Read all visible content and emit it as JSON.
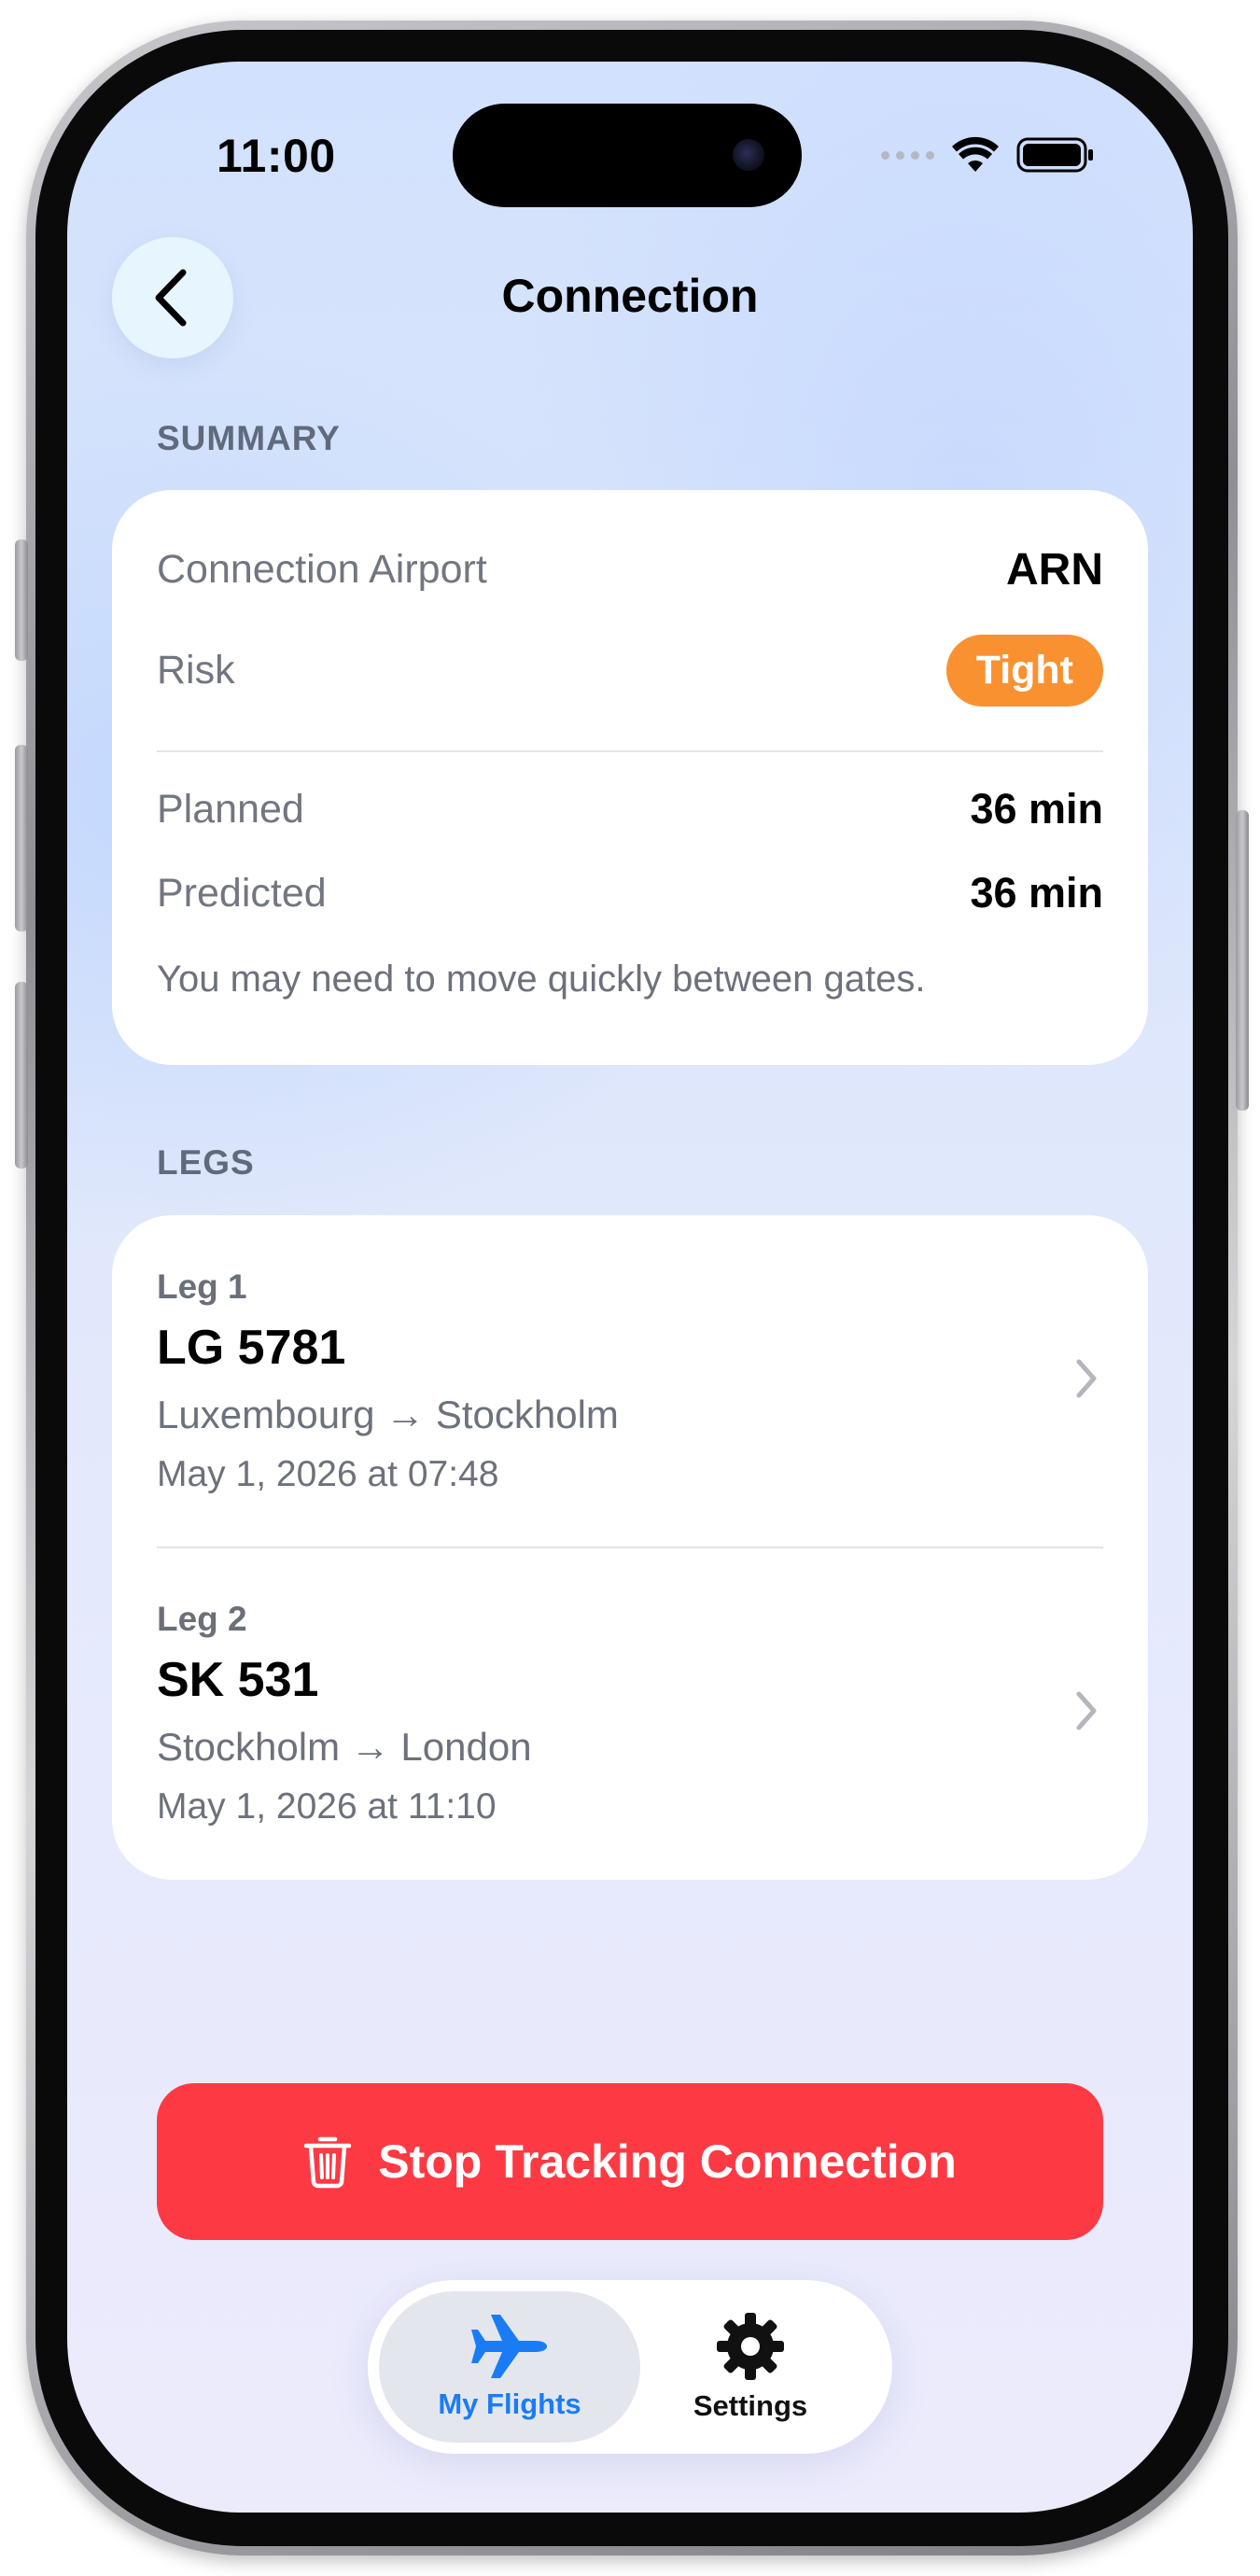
{
  "status_bar": {
    "time": "11:00"
  },
  "nav": {
    "title": "Connection"
  },
  "summary": {
    "section_label": "SUMMARY",
    "connection_airport_label": "Connection Airport",
    "connection_airport_value": "ARN",
    "risk_label": "Risk",
    "risk_value": "Tight",
    "planned_label": "Planned",
    "planned_value": "36 min",
    "predicted_label": "Predicted",
    "predicted_value": "36 min",
    "note": "You may need to move quickly between gates."
  },
  "legs": {
    "section_label": "LEGS",
    "items": [
      {
        "label": "Leg 1",
        "flight": "LG 5781",
        "route": "Luxembourg → Stockholm",
        "time": "May 1, 2026 at 07:48"
      },
      {
        "label": "Leg 2",
        "flight": "SK 531",
        "route": "Stockholm → London",
        "time": "May 1, 2026 at 11:10"
      }
    ]
  },
  "actions": {
    "stop_tracking_label": "Stop Tracking Connection"
  },
  "tabbar": {
    "tabs": [
      {
        "label": "My Flights",
        "icon": "airplane-icon",
        "active": true
      },
      {
        "label": "Settings",
        "icon": "gear-icon",
        "active": false
      }
    ]
  },
  "colors": {
    "accent_blue": "#1a7cf5",
    "risk_orange": "#f99131",
    "destructive_red": "#fd3a44"
  }
}
